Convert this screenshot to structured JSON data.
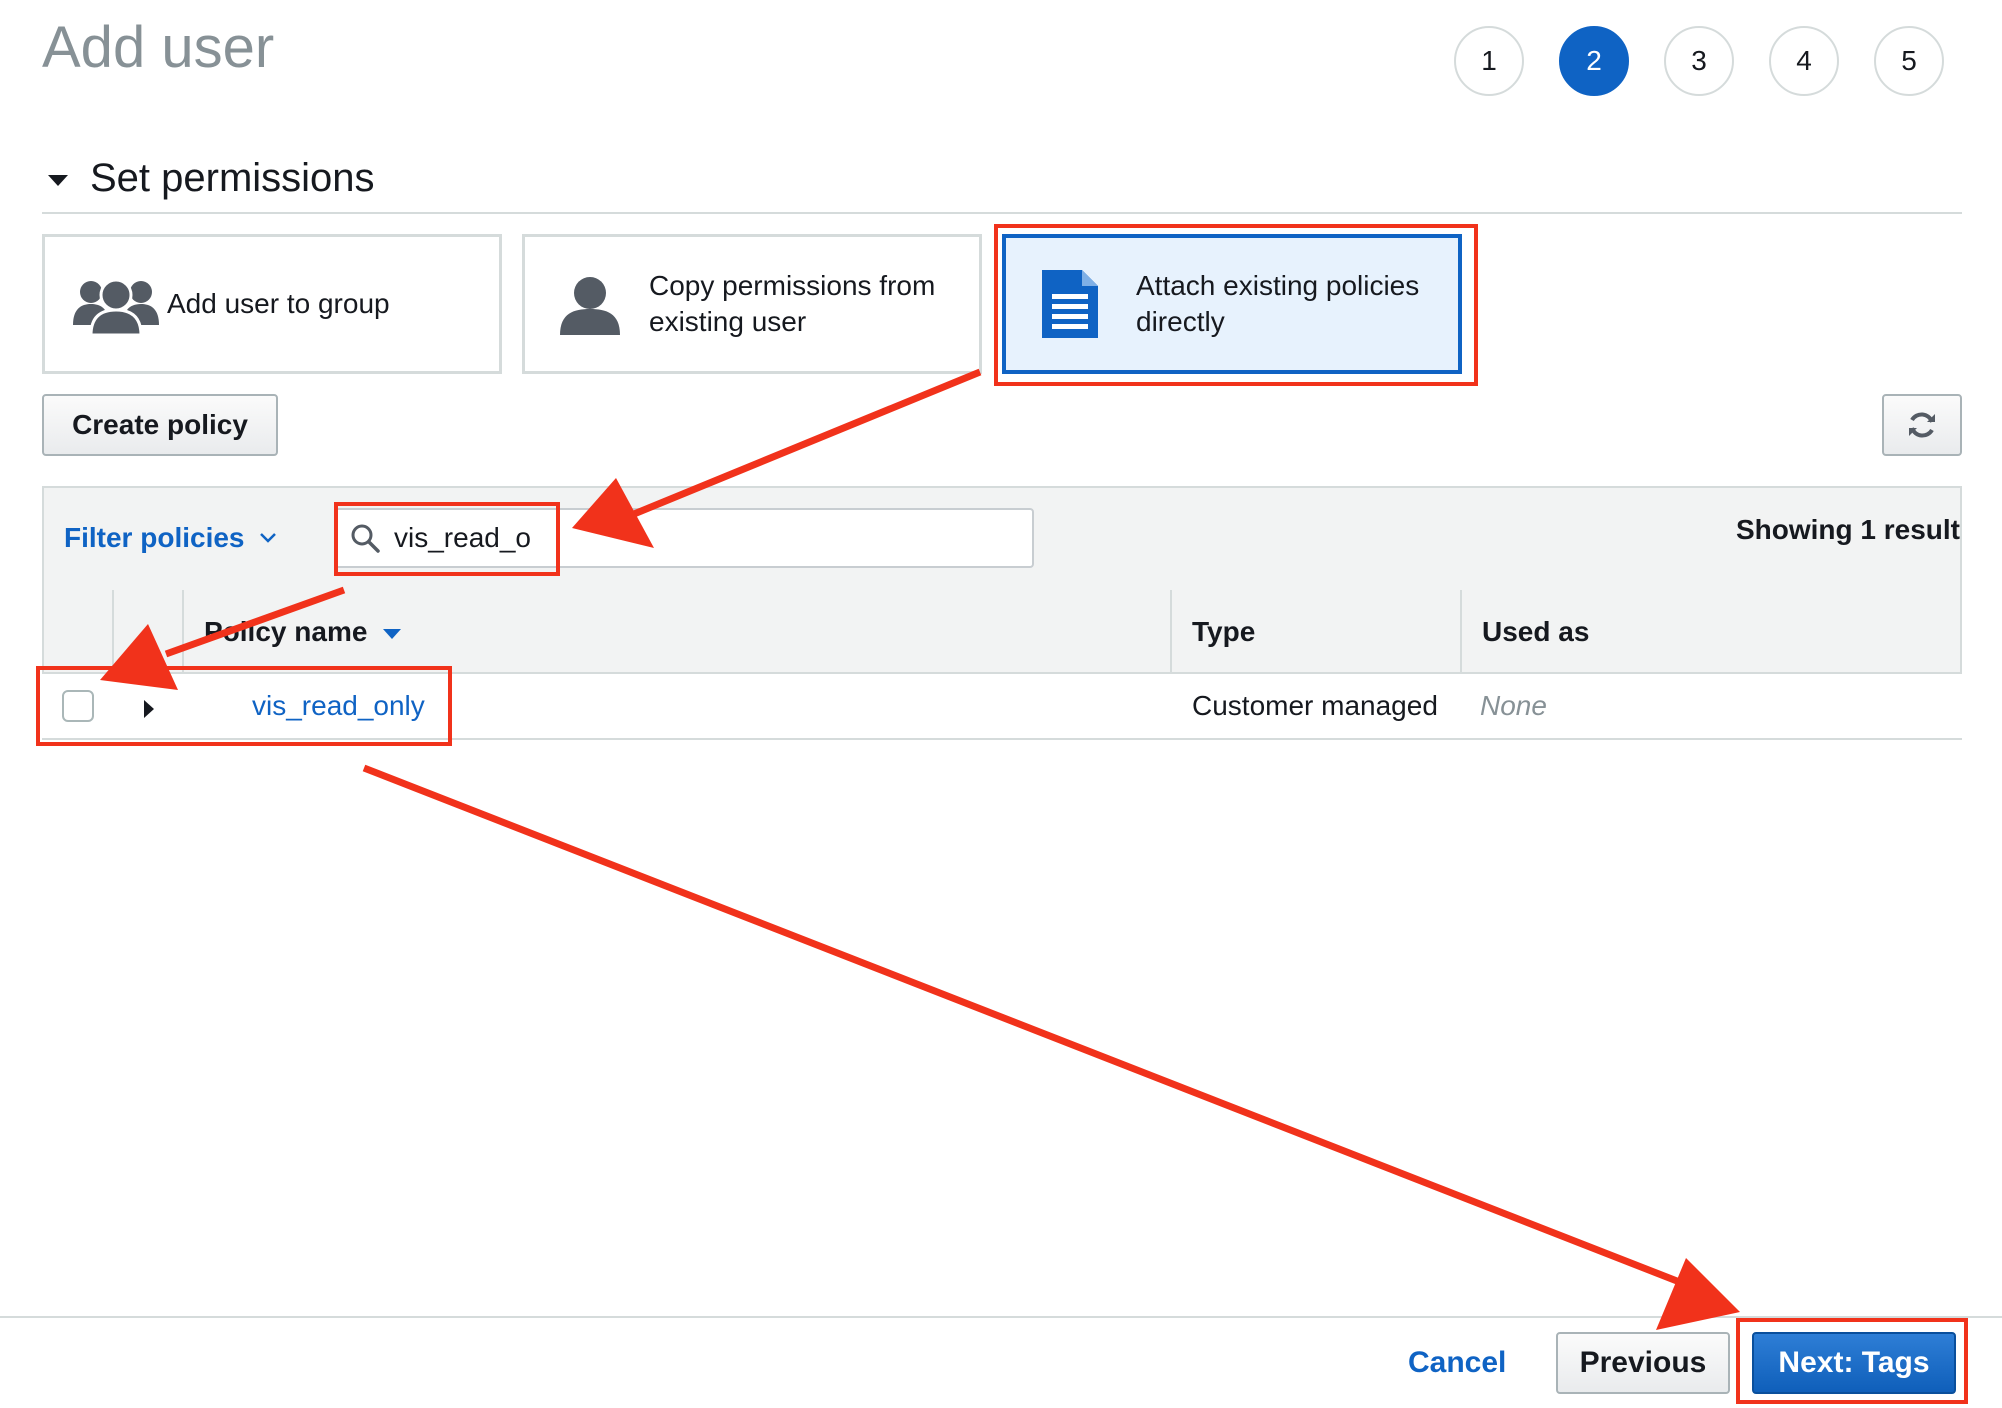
{
  "page": {
    "title": "Add user"
  },
  "steps": [
    "1",
    "2",
    "3",
    "4",
    "5"
  ],
  "active_step": "2",
  "section": {
    "title": "Set permissions"
  },
  "options": [
    {
      "label": "Add user to group",
      "icon": "users-icon"
    },
    {
      "label": "Copy permissions from existing user",
      "icon": "user-icon"
    },
    {
      "label": "Attach existing policies directly",
      "icon": "document-icon",
      "selected": true
    }
  ],
  "toolbar": {
    "create_policy_label": "Create policy",
    "refresh_icon": "refresh-icon"
  },
  "filter": {
    "label": "Filter policies",
    "search_value": "vis_read_o",
    "result_text": "Showing 1 result"
  },
  "table": {
    "columns": [
      "Policy name",
      "Type",
      "Used as"
    ],
    "rows": [
      {
        "name": "vis_read_only",
        "type": "Customer managed",
        "used_as": "None"
      }
    ]
  },
  "footer": {
    "cancel": "Cancel",
    "previous": "Previous",
    "next": "Next: Tags"
  },
  "colors": {
    "accent": "#0f63c4",
    "annotation": "#f1321b",
    "selected_bg": "#e7f2fd"
  }
}
